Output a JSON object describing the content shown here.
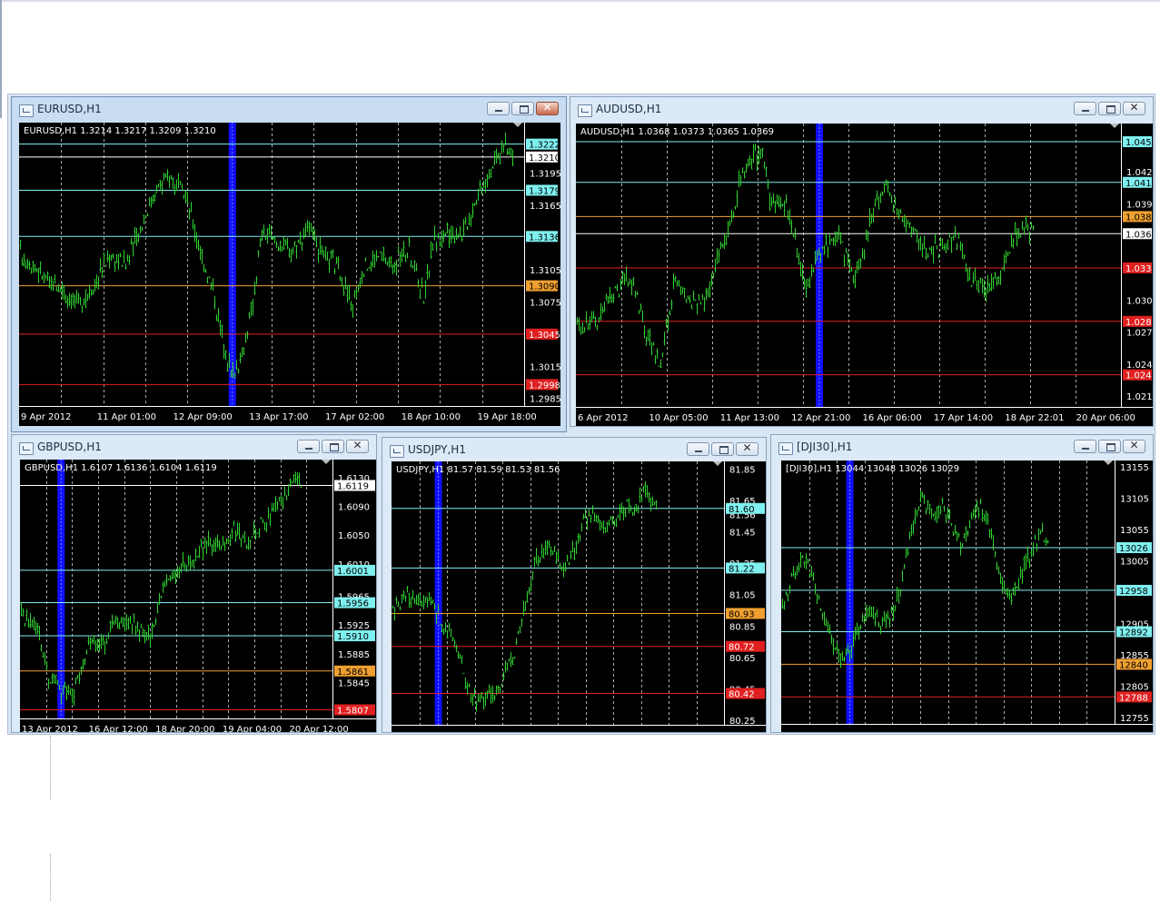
{
  "colors": {
    "background": "#000000",
    "candle": "#2fd02f",
    "grid": "#c8c8c8",
    "cyan": "#7ff0f0",
    "orange": "#f0a030",
    "red": "#e02020",
    "white": "#ffffff",
    "blueBar": "#1010ff"
  },
  "windows": [
    {
      "key": "eurusd",
      "title": "EURUSD,H1",
      "active": true
    },
    {
      "key": "audusd",
      "title": "AUDUSD,H1",
      "active": false
    },
    {
      "key": "gbpusd",
      "title": "GBPUSD,H1",
      "active": false
    },
    {
      "key": "usdjpy",
      "title": "USDJPY,H1",
      "active": false
    },
    {
      "key": "dji30",
      "title": "[DJI30],H1",
      "active": false
    }
  ],
  "chart_data": [
    {
      "type": "candlestick",
      "symbol": "EURUSD,H1",
      "info_line": "EURUSD,H1  1.3214 1.3217 1.3209 1.3210",
      "ylim": [
        1.2978,
        1.3242
      ],
      "y_ticks": [
        "1.3195",
        "1.3165",
        "1.3105",
        "1.3075",
        "1.3015",
        "1.2985"
      ],
      "x_labels": [
        "9 Apr 2012",
        "11 Apr 01:00",
        "12 Apr 09:00",
        "13 Apr 17:00",
        "17 Apr 02:00",
        "18 Apr 10:00",
        "19 Apr 18:00"
      ],
      "horizontal_levels": [
        {
          "label": "1.3222",
          "value": 1.3222,
          "color": "cyan"
        },
        {
          "label": "1.3210",
          "value": 1.321,
          "color": "white"
        },
        {
          "label": "1.3179",
          "value": 1.3179,
          "color": "cyan"
        },
        {
          "label": "1.3136",
          "value": 1.3136,
          "color": "cyan"
        },
        {
          "label": "1.3090",
          "value": 1.309,
          "color": "orange"
        },
        {
          "label": "1.3045",
          "value": 1.3045,
          "color": "red"
        },
        {
          "label": "1.2998",
          "value": 1.2998,
          "color": "red"
        }
      ],
      "close_path": [
        [
          0,
          1.312
        ],
        [
          0.03,
          1.3108
        ],
        [
          0.06,
          1.3092
        ],
        [
          0.09,
          1.3085
        ],
        [
          0.12,
          1.3072
        ],
        [
          0.15,
          1.3095
        ],
        [
          0.18,
          1.3118
        ],
        [
          0.21,
          1.311
        ],
        [
          0.24,
          1.3145
        ],
        [
          0.27,
          1.318
        ],
        [
          0.3,
          1.3192
        ],
        [
          0.33,
          1.3172
        ],
        [
          0.36,
          1.312
        ],
        [
          0.385,
          1.3082
        ],
        [
          0.4,
          1.3045
        ],
        [
          0.42,
          1.3008
        ],
        [
          0.44,
          1.3022
        ],
        [
          0.46,
          1.3068
        ],
        [
          0.48,
          1.314
        ],
        [
          0.51,
          1.313
        ],
        [
          0.54,
          1.3122
        ],
        [
          0.57,
          1.3145
        ],
        [
          0.6,
          1.3118
        ],
        [
          0.63,
          1.3108
        ],
        [
          0.66,
          1.307
        ],
        [
          0.68,
          1.3105
        ],
        [
          0.71,
          1.3118
        ],
        [
          0.74,
          1.311
        ],
        [
          0.77,
          1.3125
        ],
        [
          0.8,
          1.308
        ],
        [
          0.82,
          1.3132
        ],
        [
          0.85,
          1.314
        ],
        [
          0.88,
          1.314
        ],
        [
          0.91,
          1.318
        ],
        [
          0.94,
          1.3205
        ],
        [
          0.96,
          1.322
        ],
        [
          0.98,
          1.3213
        ]
      ],
      "marker": 0.415
    },
    {
      "type": "candlestick",
      "symbol": "AUDUSD,H1",
      "info_line": "AUDUSD,H1  1.0368 1.0373 1.0365 1.0369",
      "ylim": [
        1.02,
        1.0465
      ],
      "y_ticks": [
        "1.042",
        "1.039",
        "1.030",
        "1.027",
        "1.024",
        "1.021"
      ],
      "x_labels": [
        "6 Apr 2012",
        "10 Apr 05:00",
        "11 Apr 13:00",
        "12 Apr 21:00",
        "16 Apr 06:00",
        "17 Apr 14:00",
        "18 Apr 22:01",
        "20 Apr 06:00"
      ],
      "horizontal_levels": [
        {
          "label": "1.045",
          "value": 1.0448,
          "color": "cyan"
        },
        {
          "label": "1.041",
          "value": 1.041,
          "color": "cyan"
        },
        {
          "label": "1.038",
          "value": 1.0378,
          "color": "orange"
        },
        {
          "label": "1.036",
          "value": 1.0362,
          "color": "white"
        },
        {
          "label": "1.033",
          "value": 1.033,
          "color": "red"
        },
        {
          "label": "1.028",
          "value": 1.028,
          "color": "red"
        },
        {
          "label": "1.024",
          "value": 1.023,
          "color": "red"
        }
      ],
      "close_path": [
        [
          0,
          1.0275
        ],
        [
          0.04,
          1.0282
        ],
        [
          0.07,
          1.0305
        ],
        [
          0.1,
          1.0322
        ],
        [
          0.13,
          1.0268
        ],
        [
          0.155,
          1.024
        ],
        [
          0.18,
          1.0315
        ],
        [
          0.21,
          1.03
        ],
        [
          0.24,
          1.03
        ],
        [
          0.26,
          1.0345
        ],
        [
          0.28,
          1.0368
        ],
        [
          0.3,
          1.041
        ],
        [
          0.32,
          1.043
        ],
        [
          0.34,
          1.0438
        ],
        [
          0.36,
          1.0385
        ],
        [
          0.38,
          1.0395
        ],
        [
          0.4,
          1.036
        ],
        [
          0.42,
          1.031
        ],
        [
          0.45,
          1.0345
        ],
        [
          0.48,
          1.036
        ],
        [
          0.51,
          1.032
        ],
        [
          0.53,
          1.0355
        ],
        [
          0.55,
          1.0395
        ],
        [
          0.57,
          1.0405
        ],
        [
          0.59,
          1.0385
        ],
        [
          0.61,
          1.037
        ],
        [
          0.64,
          1.0348
        ],
        [
          0.67,
          1.0348
        ],
        [
          0.7,
          1.0358
        ],
        [
          0.72,
          1.0322
        ],
        [
          0.75,
          1.0312
        ],
        [
          0.78,
          1.0322
        ],
        [
          0.8,
          1.0355
        ],
        [
          0.82,
          1.037
        ],
        [
          0.84,
          1.0363
        ]
      ],
      "marker": 0.44
    },
    {
      "type": "candlestick",
      "symbol": "GBPUSD,H1",
      "info_line": "GBPUSD,H1  1.6107 1.6136 1.6104 1.6119",
      "ylim": [
        1.5795,
        1.6155
      ],
      "y_ticks": [
        "1.6130",
        "1.6090",
        "1.6050",
        "1.6010",
        "1.5965",
        "1.5925",
        "1.5885",
        "1.5845"
      ],
      "x_labels": [
        "13 Apr 2012",
        "16 Apr 12:00",
        "18 Apr 20:00",
        "19 Apr 04:00",
        "20 Apr 12:00"
      ],
      "horizontal_levels": [
        {
          "label": "1.6119",
          "value": 1.6119,
          "color": "white"
        },
        {
          "label": "1.6001",
          "value": 1.6001,
          "color": "cyan"
        },
        {
          "label": "1.5956",
          "value": 1.5956,
          "color": "cyan"
        },
        {
          "label": "1.5910",
          "value": 1.591,
          "color": "cyan"
        },
        {
          "label": "1.5861",
          "value": 1.5861,
          "color": "orange"
        },
        {
          "label": "1.5807",
          "value": 1.5807,
          "color": "red"
        }
      ],
      "close_path": [
        [
          0,
          1.594
        ],
        [
          0.05,
          1.5925
        ],
        [
          0.09,
          1.5855
        ],
        [
          0.13,
          1.583
        ],
        [
          0.17,
          1.5832
        ],
        [
          0.2,
          1.587
        ],
        [
          0.23,
          1.5905
        ],
        [
          0.27,
          1.5895
        ],
        [
          0.3,
          1.5935
        ],
        [
          0.34,
          1.5928
        ],
        [
          0.38,
          1.5922
        ],
        [
          0.42,
          1.591
        ],
        [
          0.45,
          1.5965
        ],
        [
          0.48,
          1.599
        ],
        [
          0.52,
          1.601
        ],
        [
          0.56,
          1.6015
        ],
        [
          0.6,
          1.604
        ],
        [
          0.64,
          1.6035
        ],
        [
          0.68,
          1.6055
        ],
        [
          0.72,
          1.6042
        ],
        [
          0.76,
          1.606
        ],
        [
          0.8,
          1.608
        ],
        [
          0.84,
          1.61
        ],
        [
          0.88,
          1.6122
        ],
        [
          0.9,
          1.6118
        ]
      ],
      "marker": 0.12
    },
    {
      "type": "candlestick",
      "symbol": "USDJPY,H1",
      "info_line": "USDJPY,H1  81.57 81.59 81.53 81.56",
      "ylim": [
        80.22,
        81.9
      ],
      "y_ticks": [
        "81.85",
        "81.65",
        "81.56",
        "81.45",
        "81.25",
        "81.05",
        "80.85",
        "80.65",
        "80.45",
        "80.25"
      ],
      "x_labels": [
        "13 Apr 2012",
        "16 Apr 04:00",
        "17 Apr 12:00",
        "18 Apr 20:00",
        "20 Apr 04:00"
      ],
      "horizontal_levels": [
        {
          "label": "81.60",
          "value": 81.6,
          "color": "cyan"
        },
        {
          "label": "81.22",
          "value": 81.22,
          "color": "cyan"
        },
        {
          "label": "80.93",
          "value": 80.93,
          "color": "orange"
        },
        {
          "label": "80.72",
          "value": 80.72,
          "color": "red"
        },
        {
          "label": "80.42",
          "value": 80.42,
          "color": "red"
        }
      ],
      "close_path": [
        [
          0,
          80.92
        ],
        [
          0.04,
          81.05
        ],
        [
          0.08,
          81.0
        ],
        [
          0.12,
          81.0
        ],
        [
          0.15,
          80.85
        ],
        [
          0.18,
          80.78
        ],
        [
          0.21,
          80.62
        ],
        [
          0.24,
          80.38
        ],
        [
          0.28,
          80.4
        ],
        [
          0.31,
          80.4
        ],
        [
          0.34,
          80.55
        ],
        [
          0.37,
          80.68
        ],
        [
          0.4,
          80.95
        ],
        [
          0.43,
          81.25
        ],
        [
          0.46,
          81.35
        ],
        [
          0.49,
          81.3
        ],
        [
          0.52,
          81.22
        ],
        [
          0.55,
          81.35
        ],
        [
          0.58,
          81.55
        ],
        [
          0.61,
          81.55
        ],
        [
          0.64,
          81.48
        ],
        [
          0.67,
          81.52
        ],
        [
          0.7,
          81.62
        ],
        [
          0.73,
          81.58
        ],
        [
          0.76,
          81.7
        ],
        [
          0.78,
          81.65
        ],
        [
          0.8,
          81.56
        ]
      ],
      "marker": 0.13
    },
    {
      "type": "candlestick",
      "symbol": "[DJI30],H1",
      "info_line": "[DJI30],H1  13044 13048 13026 13029",
      "ylim": [
        12745,
        13165
      ],
      "y_ticks": [
        "13155",
        "13105",
        "13055",
        "13005",
        "12955",
        "12905",
        "12855",
        "12805",
        "12755"
      ],
      "x_labels": [],
      "horizontal_levels": [
        {
          "label": "13026",
          "value": 13026,
          "color": "cyan"
        },
        {
          "label": "12958",
          "value": 12958,
          "color": "cyan"
        },
        {
          "label": "12892",
          "value": 12892,
          "color": "cyan"
        },
        {
          "label": "12840",
          "value": 12840,
          "color": "orange"
        },
        {
          "label": "12788",
          "value": 12788,
          "color": "red"
        }
      ],
      "close_path": [
        [
          0,
          12920
        ],
        [
          0.03,
          12975
        ],
        [
          0.06,
          13005
        ],
        [
          0.09,
          12985
        ],
        [
          0.12,
          12930
        ],
        [
          0.15,
          12880
        ],
        [
          0.18,
          12840
        ],
        [
          0.21,
          12860
        ],
        [
          0.24,
          12905
        ],
        [
          0.27,
          12930
        ],
        [
          0.3,
          12900
        ],
        [
          0.33,
          12920
        ],
        [
          0.36,
          12970
        ],
        [
          0.39,
          13050
        ],
        [
          0.42,
          13110
        ],
        [
          0.45,
          13080
        ],
        [
          0.48,
          13090
        ],
        [
          0.51,
          13060
        ],
        [
          0.54,
          13030
        ],
        [
          0.57,
          13070
        ],
        [
          0.6,
          13090
        ],
        [
          0.63,
          13050
        ],
        [
          0.66,
          12960
        ],
        [
          0.69,
          12945
        ],
        [
          0.72,
          12985
        ],
        [
          0.75,
          13020
        ],
        [
          0.78,
          13055
        ],
        [
          0.8,
          13030
        ]
      ],
      "marker": 0.195
    }
  ]
}
